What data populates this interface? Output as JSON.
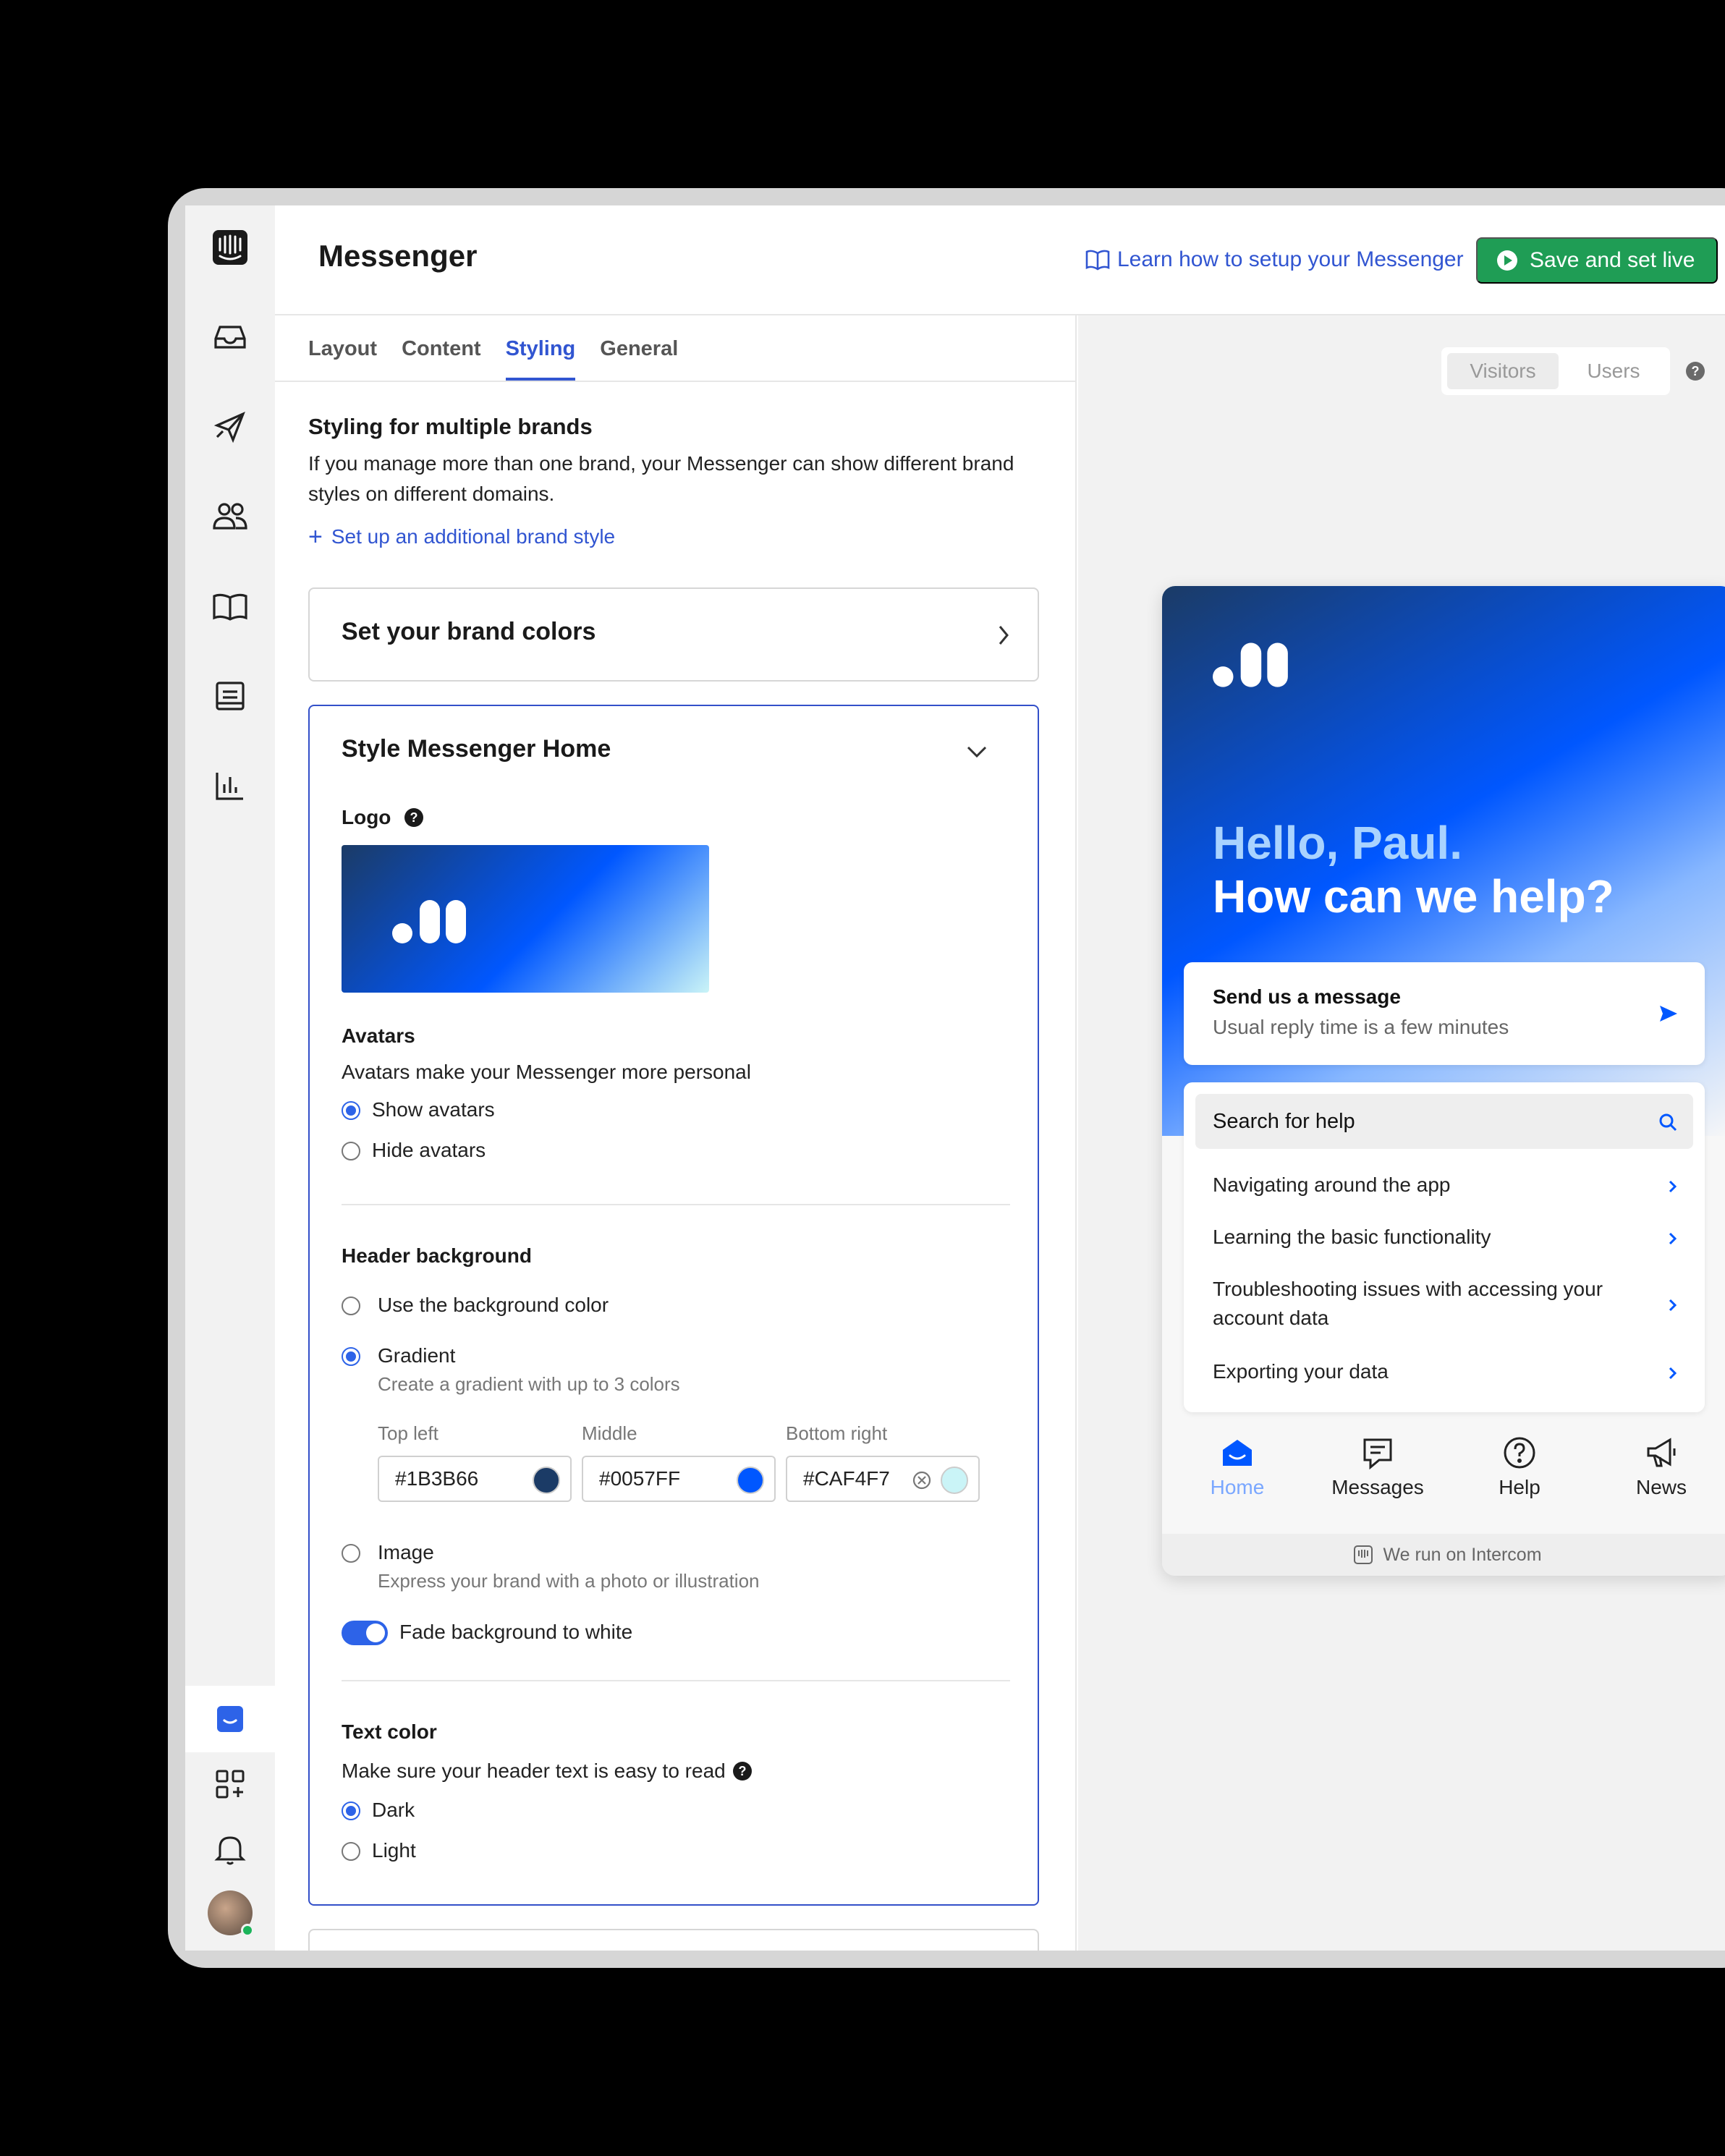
{
  "app": {
    "page_title": "Messenger",
    "learn_link": "Learn how to setup your Messenger",
    "save_button": "Save and set live"
  },
  "rail": {
    "icons": [
      "intercom-logo-icon",
      "inbox-icon",
      "outbound-icon",
      "contacts-icon",
      "articles-icon",
      "reports-doc-icon",
      "reports-chart-icon",
      "messenger-icon",
      "apps-icon",
      "notifications-icon"
    ]
  },
  "tabs": [
    "Layout",
    "Content",
    "Styling",
    "General"
  ],
  "active_tab": "Styling",
  "multi_brand": {
    "title": "Styling for multiple brands",
    "description": "If you manage more than one brand, your Messenger can show different brand styles on different domains.",
    "add_link": "Set up an additional brand style"
  },
  "brand_colors_card": {
    "title": "Set your brand colors"
  },
  "style_home": {
    "title": "Style Messenger Home",
    "logo_label": "Logo",
    "avatars": {
      "title": "Avatars",
      "description": "Avatars make your Messenger more personal",
      "options": [
        "Show avatars",
        "Hide avatars"
      ],
      "selected": "Show avatars"
    },
    "header_bg": {
      "title": "Header background",
      "opt_color": "Use the background color",
      "opt_gradient": "Gradient",
      "gradient_desc": "Create a gradient with up to 3 colors",
      "selected": "Gradient",
      "stops": [
        {
          "label": "Top left",
          "value": "#1B3B66",
          "color": "#1B3B66"
        },
        {
          "label": "Middle",
          "value": "#0057FF",
          "color": "#0057FF"
        },
        {
          "label": "Bottom right",
          "value": "#CAF4F7",
          "color": "#CAF4F7"
        }
      ],
      "opt_image": "Image",
      "image_desc": "Express your brand with a photo or illustration",
      "fade_label": "Fade background to white",
      "fade_on": true
    },
    "text_color": {
      "title": "Text color",
      "description": "Make sure your header text is easy to read",
      "options": [
        "Dark",
        "Light"
      ],
      "selected": "Dark"
    }
  },
  "preview": {
    "segment": [
      "Visitors",
      "Users"
    ],
    "selected_segment": "Visitors",
    "greeting_1": "Hello, Paul.",
    "greeting_2": "How can we help?",
    "send": {
      "title": "Send us a message",
      "subtitle": "Usual reply time is a few minutes"
    },
    "search_placeholder": "Search for help",
    "articles": [
      "Navigating around the app",
      "Learning the basic functionality",
      "Troubleshooting issues with accessing your account data",
      "Exporting your data"
    ],
    "nav": [
      "Home",
      "Messages",
      "Help",
      "News"
    ],
    "active_nav": "Home",
    "footer": "We run on Intercom"
  },
  "colors": {
    "accent": "#3155D1",
    "save_green": "#1F9D55",
    "radio_blue": "#2D63E8"
  }
}
